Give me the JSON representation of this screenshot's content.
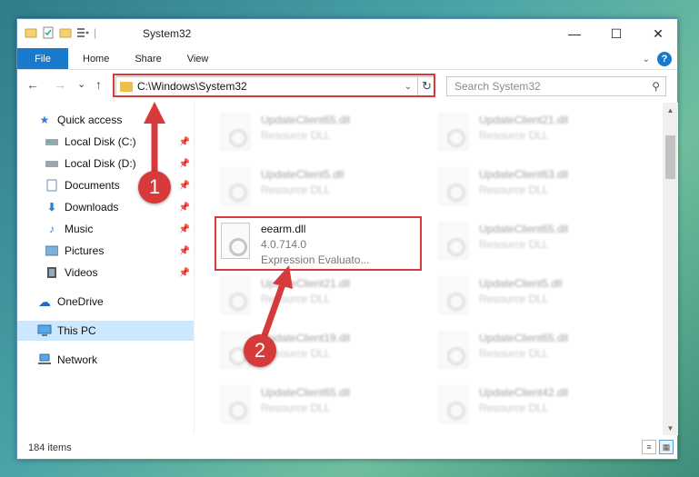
{
  "window": {
    "title": "System32",
    "controls": {
      "minimize": "—",
      "maximize": "☐",
      "close": "✕"
    }
  },
  "ribbon": {
    "tabs": [
      "File",
      "Home",
      "Share",
      "View"
    ],
    "help_label": "?"
  },
  "navbar": {
    "back": "←",
    "forward": "→",
    "recent": "⌄",
    "up": "↑",
    "address": "C:\\Windows\\System32",
    "search_placeholder": "Search System32"
  },
  "sidebar": {
    "items": [
      {
        "label": "Quick access",
        "icon": "star-icon",
        "pinned": false
      },
      {
        "label": "Local Disk (C:)",
        "icon": "drive-icon",
        "pinned": true
      },
      {
        "label": "Local Disk (D:)",
        "icon": "drive-icon",
        "pinned": true
      },
      {
        "label": "Documents",
        "icon": "documents-icon",
        "pinned": true
      },
      {
        "label": "Downloads",
        "icon": "downloads-icon",
        "pinned": true
      },
      {
        "label": "Music",
        "icon": "music-icon",
        "pinned": true
      },
      {
        "label": "Pictures",
        "icon": "pictures-icon",
        "pinned": true
      },
      {
        "label": "Videos",
        "icon": "videos-icon",
        "pinned": true
      },
      {
        "label": "OneDrive",
        "icon": "cloud-icon",
        "pinned": false
      },
      {
        "label": "This PC",
        "icon": "computer-icon",
        "pinned": false,
        "selected": true
      },
      {
        "label": "Network",
        "icon": "network-icon",
        "pinned": false
      }
    ]
  },
  "files": [
    {
      "name": "UpdateClient65.dll",
      "type": "Resource DLL"
    },
    {
      "name": "UpdateClient21.dll",
      "type": "Resource DLL"
    },
    {
      "name": "UpdateClient5.dll",
      "type": "Resource DLL"
    },
    {
      "name": "UpdateClient63.dll",
      "type": "Resource DLL"
    },
    {
      "name": "eearm.dll",
      "version": "4.0.714.0",
      "type": "Expression Evaluato...",
      "highlighted": true
    },
    {
      "name": "UpdateClient65.dll",
      "type": "Resource DLL"
    },
    {
      "name": "UpdateClient21.dll",
      "type": "Resource DLL"
    },
    {
      "name": "UpdateClient5.dll",
      "type": "Resource DLL"
    },
    {
      "name": "UpdateClient19.dll",
      "type": "Resource DLL"
    },
    {
      "name": "UpdateClient65.dll",
      "type": "Resource DLL"
    },
    {
      "name": "UpdateClient65.dll",
      "type": "Resource DLL"
    },
    {
      "name": "UpdateClient42.dll",
      "type": "Resource DLL"
    }
  ],
  "status": {
    "item_count": "184 items"
  },
  "annotations": {
    "step1": "1",
    "step2": "2",
    "color": "#d63a3a"
  }
}
